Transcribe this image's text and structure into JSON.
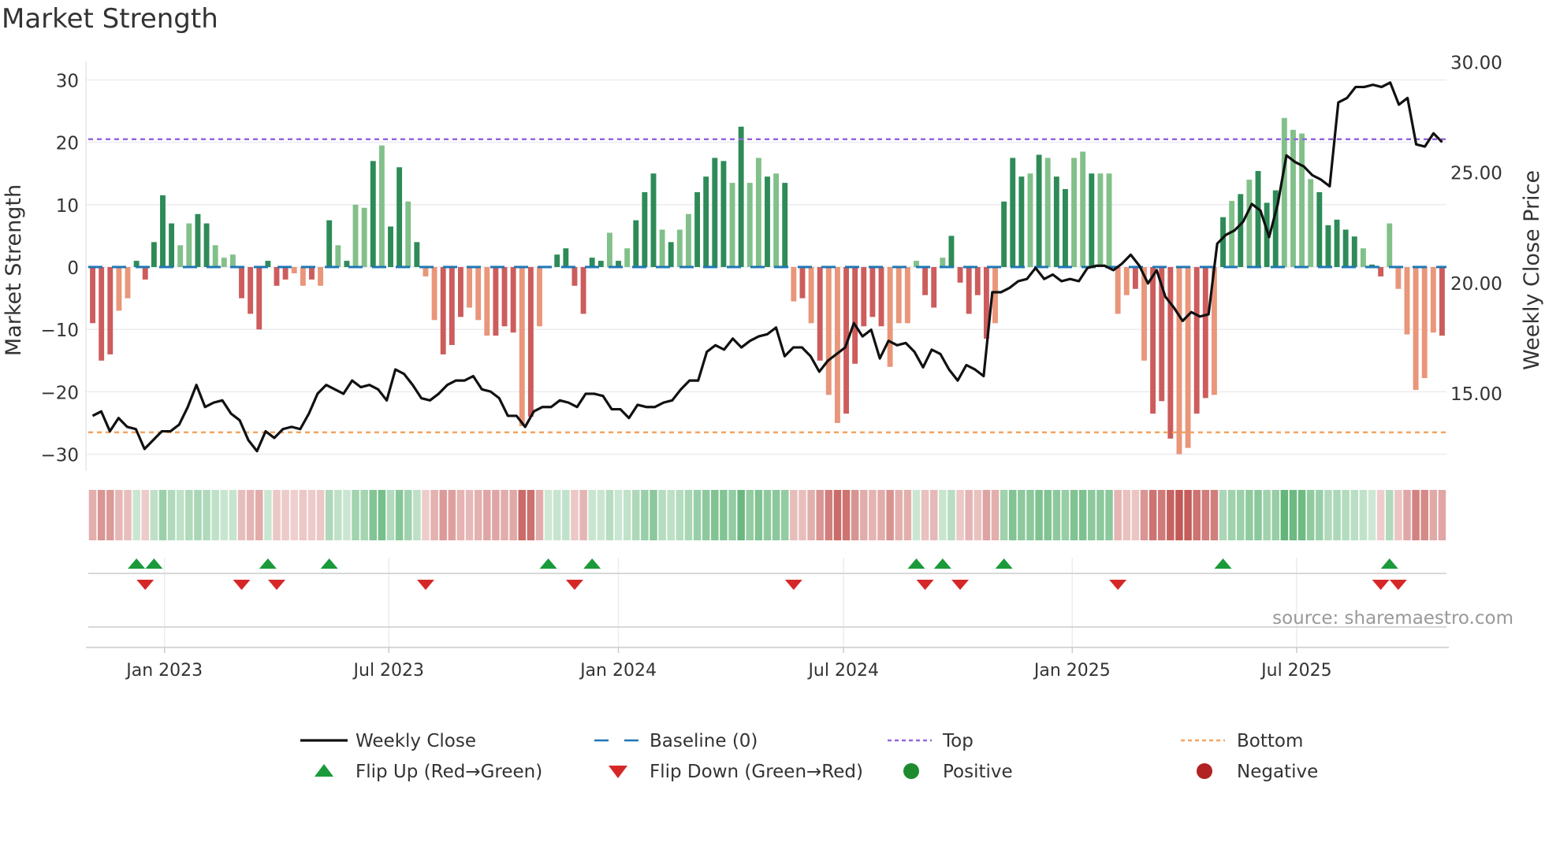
{
  "title": "Market Strength",
  "source": "source: sharemaestro.com",
  "colors": {
    "pos_strong": "#2e8b57",
    "pos_weak": "#82c08a",
    "neg_strong": "#cd5c5c",
    "neg_weak": "#e9967a",
    "baseline": "#1f77b4",
    "top": "#9467db",
    "bottom": "#f4a460",
    "price": "#111111",
    "flip_up": "#1a9a3a",
    "flip_down": "#d62728",
    "positive": "#1e8c2e",
    "negative": "#b22222"
  },
  "chart_data": {
    "type": "bar",
    "title": "Market Strength",
    "ylabel": "Market Strength",
    "y2label": "Weekly Close Price",
    "ylim": [
      -32.7,
      31.7
    ],
    "y2lim": [
      11.5,
      29.7
    ],
    "yticks": [
      -30,
      -20,
      -10,
      0,
      10,
      20,
      30
    ],
    "yticklabels": [
      "−30",
      "−20",
      "−10",
      "0",
      "10",
      "20",
      "30"
    ],
    "y2ticks": [
      15,
      20,
      25,
      30
    ],
    "y2ticklabels": [
      "15.00",
      "20.00",
      "25.00",
      "30.00"
    ],
    "xticks": [
      {
        "week": 8.2,
        "label": "Jan 2023"
      },
      {
        "week": 33.8,
        "label": "Jul 2023"
      },
      {
        "week": 60,
        "label": "Jan 2024"
      },
      {
        "week": 85.7,
        "label": "Jul 2024"
      },
      {
        "week": 111.8,
        "label": "Jan 2025"
      },
      {
        "week": 137.4,
        "label": "Jul 2025"
      }
    ],
    "top_level": 20.5,
    "bottom_level": -26.5,
    "strength": [
      -9,
      -15,
      -14,
      -7,
      -5,
      1,
      -2,
      4,
      11.5,
      7,
      3.5,
      7,
      8.5,
      7,
      3.5,
      1.5,
      2,
      -5,
      -7.5,
      -10,
      1,
      -3,
      -2,
      -1,
      -3,
      -2,
      -3,
      7.5,
      3.5,
      1,
      10,
      9.5,
      17,
      19.5,
      6.5,
      16,
      10.5,
      4,
      -1.5,
      -8.5,
      -14,
      -12.5,
      -8,
      -6.5,
      -8.5,
      -11,
      -11,
      -9.5,
      -10.5,
      -25.5,
      -24,
      -9.5,
      0.2,
      2,
      3,
      -3,
      -7.5,
      1.5,
      1,
      5.5,
      1,
      3,
      7.5,
      12,
      15,
      6,
      4,
      6,
      8.5,
      12,
      14.5,
      17.5,
      17,
      13.5,
      22.5,
      13.5,
      17.5,
      14.5,
      15,
      13.5,
      -5.5,
      -5,
      -9,
      -15,
      -20.5,
      -25,
      -23.5,
      -15.5,
      -9.5,
      -8,
      -9.5,
      -16,
      -9,
      -9,
      1,
      -4.5,
      -6.5,
      1.5,
      5,
      -2.5,
      -7.5,
      -4.5,
      -11.5,
      -9,
      10.5,
      17.5,
      14.5,
      15,
      18,
      17.5,
      14.5,
      12.5,
      17.5,
      18.5,
      15,
      15,
      15,
      -7.5,
      -4.5,
      -3.5,
      -15,
      -23.5,
      -21.5,
      -27.5,
      -30,
      -29,
      -23.5,
      -21,
      -20.5,
      8,
      10.6,
      11.7,
      14,
      15.4,
      10.3,
      12.3,
      23.9,
      22,
      21.4,
      14.1,
      12,
      6.7,
      7.6,
      6,
      4.9,
      3,
      0.4,
      -1.5,
      7,
      -3.5,
      -10.8,
      -19.7,
      -17.8,
      -10.5,
      -11
    ],
    "strength_shade": "dddlldddddllddlllddddddlldldldlldlddldlldddllldddldllddddddldldddldllddddldlldldldldlldddddllllddldddddldddldlddlldlllldldddllddldldldddlllldddddlddlllllldllllldddddlld",
    "weekly_close": [
      14.0,
      14.2,
      13.3,
      13.9,
      13.5,
      13.4,
      12.5,
      12.9,
      13.3,
      13.3,
      13.6,
      14.4,
      15.4,
      14.4,
      14.6,
      14.7,
      14.1,
      13.8,
      12.9,
      12.4,
      13.3,
      13.0,
      13.4,
      13.5,
      13.4,
      14.1,
      15.0,
      15.4,
      15.2,
      15.0,
      15.6,
      15.3,
      15.4,
      15.2,
      14.7,
      16.1,
      15.9,
      15.4,
      14.8,
      14.7,
      15.0,
      15.4,
      15.6,
      15.6,
      15.8,
      15.2,
      15.1,
      14.8,
      14.0,
      14.0,
      13.5,
      14.2,
      14.4,
      14.4,
      14.7,
      14.6,
      14.4,
      15.0,
      15.0,
      14.9,
      14.3,
      14.3,
      13.9,
      14.5,
      14.4,
      14.4,
      14.6,
      14.7,
      15.2,
      15.6,
      15.6,
      16.9,
      17.2,
      17.0,
      17.5,
      17.1,
      17.4,
      17.6,
      17.7,
      18.0,
      16.7,
      17.1,
      17.1,
      16.7,
      16.0,
      16.5,
      16.8,
      17.1,
      18.2,
      17.6,
      17.9,
      16.6,
      17.4,
      17.2,
      17.3,
      16.9,
      16.2,
      17.0,
      16.8,
      16.1,
      15.6,
      16.3,
      16.1,
      15.8,
      19.6,
      19.6,
      19.8,
      20.1,
      20.2,
      20.7,
      20.2,
      20.4,
      20.1,
      20.2,
      20.1,
      20.7,
      20.8,
      20.8,
      20.6,
      20.9,
      21.3,
      20.8,
      20.0,
      20.6,
      19.4,
      18.9,
      18.3,
      18.7,
      18.5,
      18.6,
      21.8,
      22.2,
      22.4,
      22.8,
      23.6,
      23.3,
      22.1,
      23.6,
      25.8,
      25.5,
      25.3,
      24.9,
      24.7,
      24.4,
      28.2,
      28.4,
      28.9,
      28.9,
      29.0,
      28.9,
      29.1,
      28.1,
      28.4,
      26.3,
      26.2,
      26.8,
      26.4
    ],
    "flip_up_weeks": [
      5,
      7,
      20,
      27,
      52,
      57,
      94,
      97,
      104,
      129,
      148
    ],
    "flip_down_weeks": [
      6,
      17,
      21,
      38,
      55,
      80,
      95,
      99,
      117,
      147,
      149
    ]
  },
  "legend": [
    {
      "label": "Weekly Close",
      "kind": "line"
    },
    {
      "label": "Baseline (0)",
      "kind": "baseline"
    },
    {
      "label": "Top",
      "kind": "top"
    },
    {
      "label": "Bottom",
      "kind": "bottom"
    },
    {
      "label": "Flip Up (Red→Green)",
      "kind": "up"
    },
    {
      "label": "Flip Down (Green→Red)",
      "kind": "down"
    },
    {
      "label": "Positive",
      "kind": "pos"
    },
    {
      "label": "Negative",
      "kind": "neg"
    }
  ]
}
